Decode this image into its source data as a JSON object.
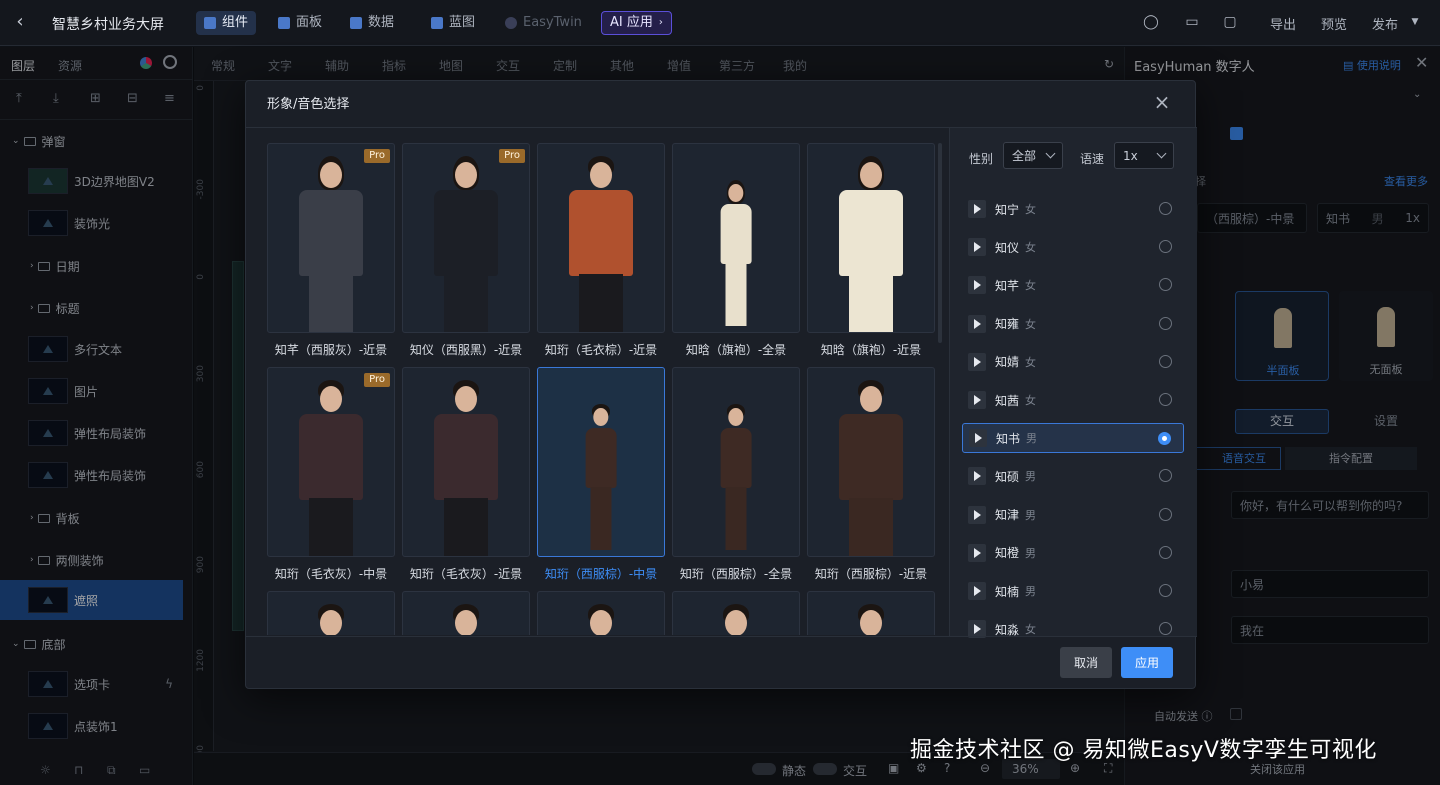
{
  "app": {
    "title": "智慧乡村业务大屏"
  },
  "nav": {
    "tabs": [
      {
        "label": "组件",
        "active": true
      },
      {
        "label": "面板"
      },
      {
        "label": "数据"
      },
      {
        "label": "蓝图"
      },
      {
        "label": "EasyTwin"
      },
      {
        "label": "AI 应用"
      }
    ]
  },
  "topright": {
    "export": "导出",
    "preview": "预览",
    "publish": "发布"
  },
  "left": {
    "tabs": [
      "图层",
      "资源"
    ],
    "groups": {
      "popup": "弹窗",
      "date": "日期",
      "title": "标题",
      "bg": "背板",
      "sides": "两侧装饰",
      "bottom": "底部"
    },
    "layers": [
      "3D边界地图V2",
      "装饰光",
      "多行文本",
      "图片",
      "弹性布局装饰",
      "弹性布局装饰",
      "遮照",
      "选项卡",
      "点装饰1"
    ]
  },
  "componentTabs": [
    "常规",
    "文字",
    "辅助",
    "指标",
    "地图",
    "交互",
    "定制",
    "其他",
    "增值",
    "第三方",
    "我的"
  ],
  "ruler": [
    "0",
    "-300",
    "0",
    "300",
    "600",
    "900",
    "1200",
    "1500"
  ],
  "bottombar": {
    "static": "静态",
    "interact": "交互",
    "zoom": "36%"
  },
  "right": {
    "title": "EasyHuman 数字人",
    "help": "使用说明",
    "viewMore": "查看更多",
    "fragment": "择",
    "voiceCurrent": {
      "avatar": "（西服棕）-中景",
      "voice": "知书",
      "sex": "男",
      "speed": "1x"
    },
    "panels": [
      "半面板",
      "无面板"
    ],
    "tabs": [
      "交互",
      "设置"
    ],
    "subtabs": [
      "语音交互",
      "指令配置"
    ],
    "greeting": "你好，有什么可以帮到你的吗?",
    "name": "小易",
    "reply": "我在",
    "autoSend": "自动发送",
    "closeApp": "关闭该应用"
  },
  "modal": {
    "title": "形象/音色选择",
    "avatars": [
      {
        "label": "知芊（西服灰）-近景",
        "pro": true,
        "style": "grey-suit-f"
      },
      {
        "label": "知仪（西服黑）-近景",
        "pro": true,
        "style": "black-suit-f"
      },
      {
        "label": "知珩（毛衣棕）-近景",
        "pro": false,
        "style": "brown-sweater"
      },
      {
        "label": "知晗（旗袍）-全景",
        "pro": false,
        "style": "qipao-full"
      },
      {
        "label": "知晗（旗袍）-近景",
        "pro": false,
        "style": "qipao-close"
      },
      {
        "label": "知珩（毛衣灰）-中景",
        "pro": true,
        "style": "grey-vest-mid"
      },
      {
        "label": "知珩（毛衣灰）-近景",
        "pro": false,
        "style": "grey-vest-close"
      },
      {
        "label": "知珩（西服棕）-中景",
        "pro": false,
        "style": "brown-suit-mid",
        "selected": true
      },
      {
        "label": "知珩（西服棕）-全景",
        "pro": false,
        "style": "brown-suit-full"
      },
      {
        "label": "知珩（西服棕）-近景",
        "pro": false,
        "style": "brown-suit-close"
      }
    ],
    "pro_label": "Pro",
    "filters": {
      "gender_label": "性别",
      "gender_value": "全部",
      "speed_label": "语速",
      "speed_value": "1x"
    },
    "voices": [
      {
        "name": "知宁",
        "sex": "女"
      },
      {
        "name": "知仪",
        "sex": "女"
      },
      {
        "name": "知芊",
        "sex": "女"
      },
      {
        "name": "知雍",
        "sex": "女"
      },
      {
        "name": "知婧",
        "sex": "女"
      },
      {
        "name": "知茜",
        "sex": "女"
      },
      {
        "name": "知书",
        "sex": "男",
        "selected": true
      },
      {
        "name": "知硕",
        "sex": "男"
      },
      {
        "name": "知津",
        "sex": "男"
      },
      {
        "name": "知橙",
        "sex": "男"
      },
      {
        "name": "知楠",
        "sex": "男"
      },
      {
        "name": "知淼",
        "sex": "女"
      }
    ],
    "cancel": "取消",
    "apply": "应用"
  },
  "watermark": "掘金技术社区 @ 易知微EasyV数字孪生可视化",
  "colors": {
    "accent": "#3e8ef7",
    "pro": "#9a6a2a",
    "selectedLayer": "#1f4f93"
  }
}
